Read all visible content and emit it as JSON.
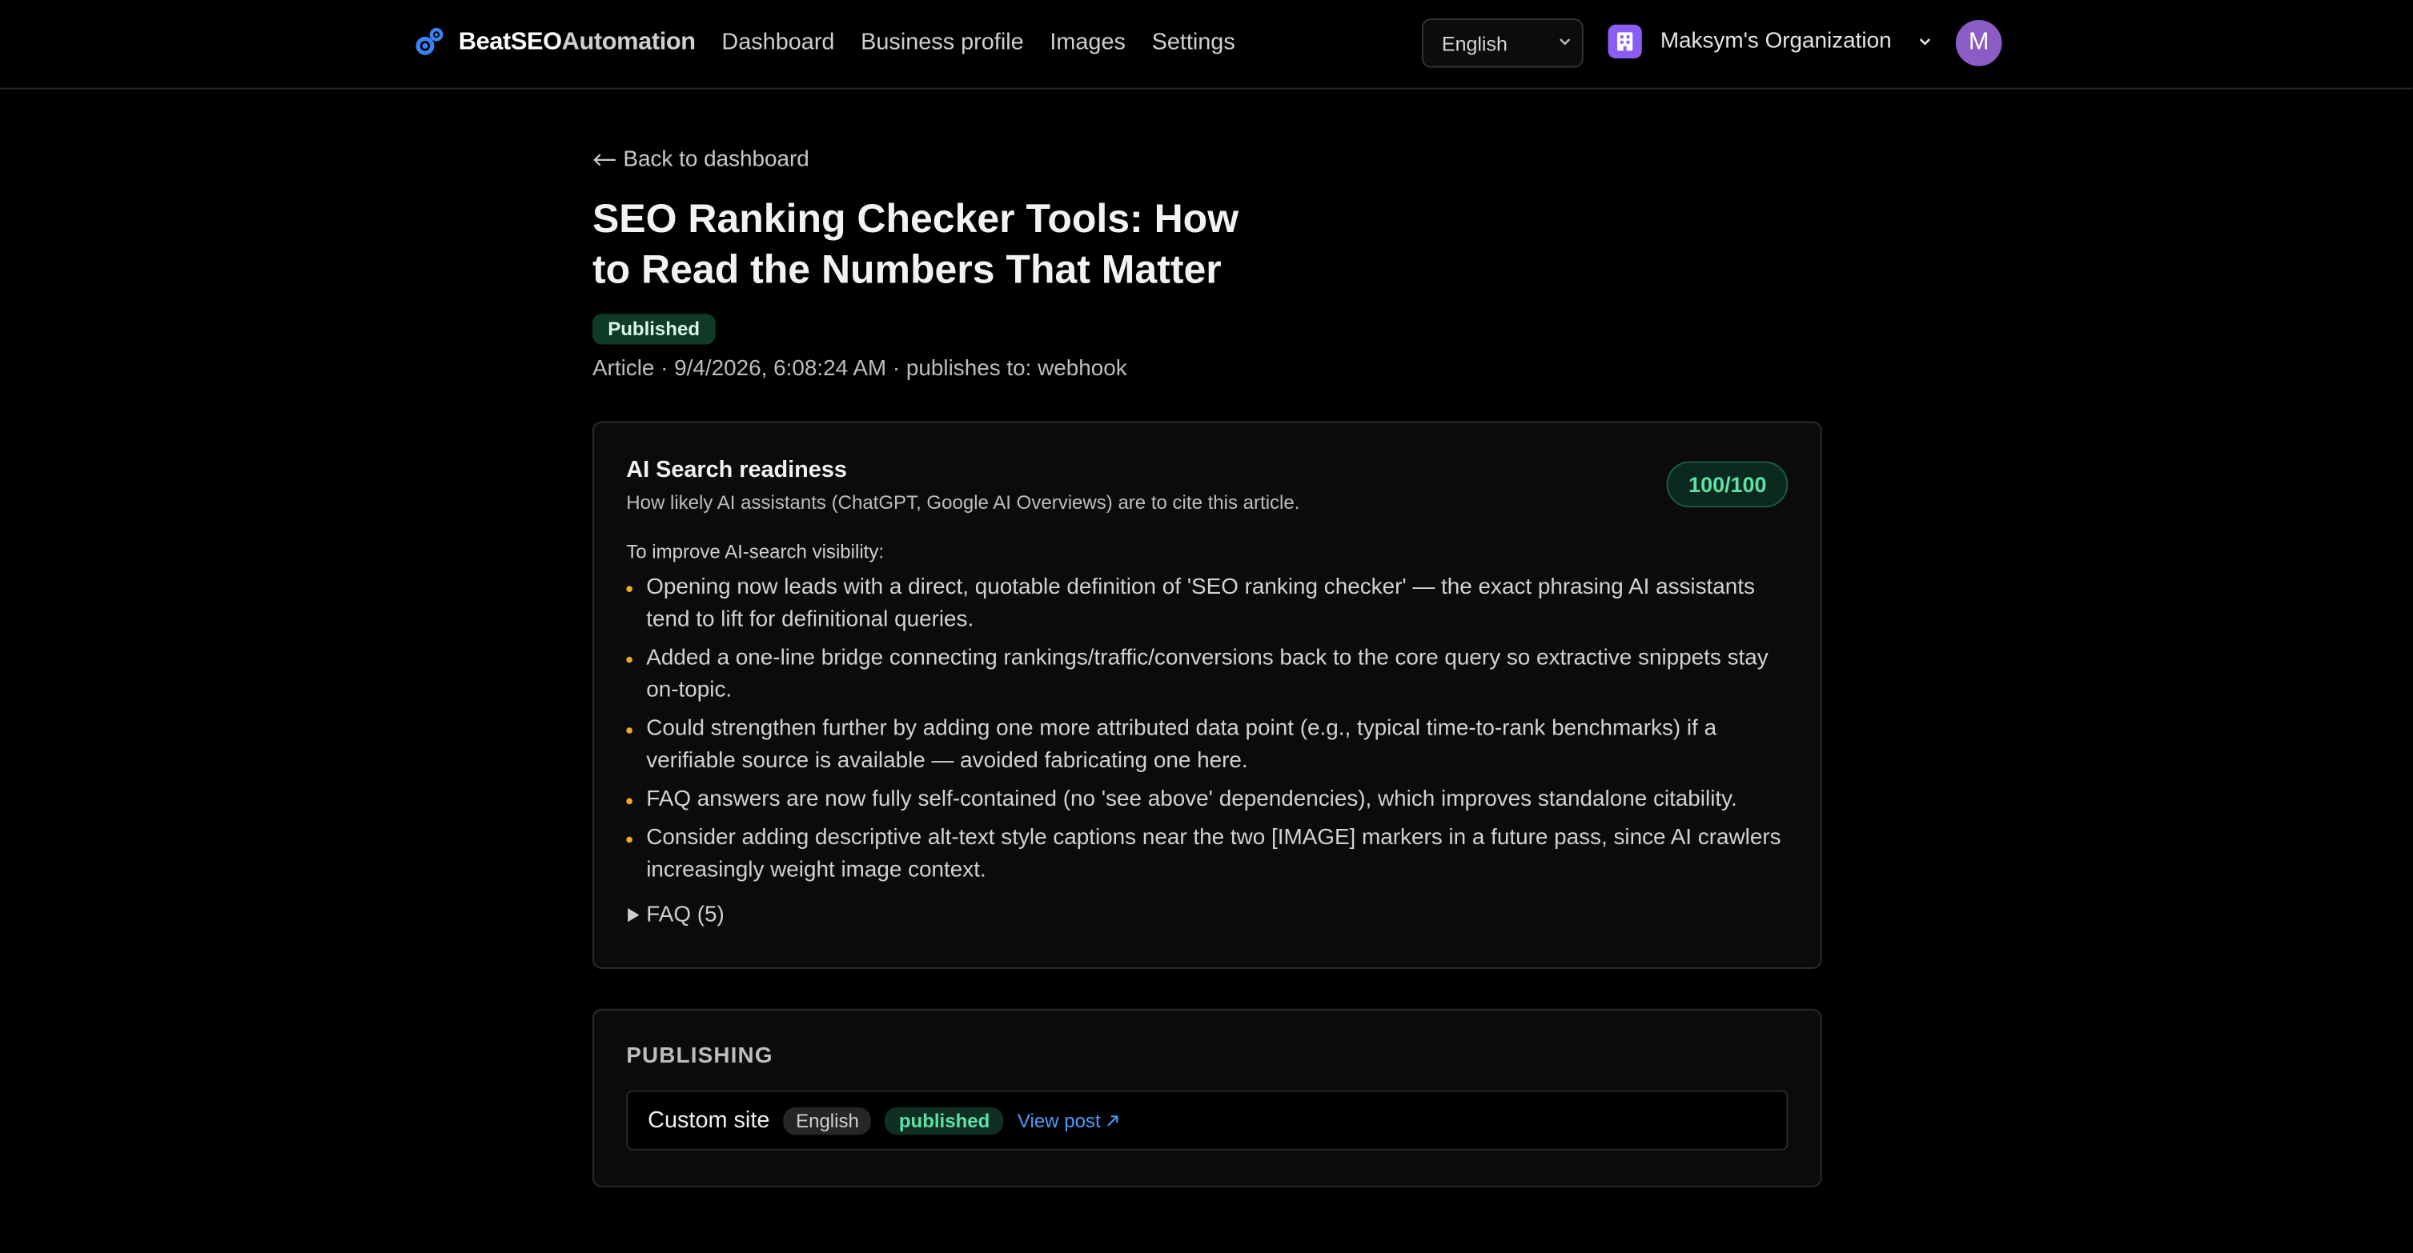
{
  "header": {
    "brand_bold": "BeatSEO",
    "brand_light": "Automation",
    "nav": [
      "Dashboard",
      "Business profile",
      "Images",
      "Settings"
    ],
    "language": "English",
    "org_name": "Maksym's Organization",
    "avatar_initial": "M"
  },
  "article": {
    "back_label": "Back to dashboard",
    "title": "SEO Ranking Checker Tools: How to Read the Numbers That Matter",
    "status": "Published",
    "meta": "Article · 9/4/2026, 6:08:24 AM · publishes to: webhook"
  },
  "ai_card": {
    "title": "AI Search readiness",
    "subtitle": "How likely AI assistants (ChatGPT, Google AI Overviews) are to cite this article.",
    "score": "100/100",
    "improve_label": "To improve AI-search visibility:",
    "bullets": [
      "Opening now leads with a direct, quotable definition of 'SEO ranking checker' — the exact phrasing AI assistants tend to lift for definitional queries.",
      "Added a one-line bridge connecting rankings/traffic/conversions back to the core query so extractive snippets stay on-topic.",
      "Could strengthen further by adding one more attributed data point (e.g., typical time-to-rank benchmarks) if a verifiable source is available — avoided fabricating one here.",
      "FAQ answers are now fully self-contained (no 'see above' dependencies), which improves standalone citability.",
      "Consider adding descriptive alt-text style captions near the two [IMAGE] markers in a future pass, since AI crawlers increasingly weight image context."
    ],
    "faq_label": "FAQ (5)"
  },
  "publishing": {
    "heading": "PUBLISHING",
    "site": "Custom site",
    "language": "English",
    "status": "published",
    "view_label": "View post"
  },
  "colors": {
    "background": "#000000",
    "accent_green": "#5ee0a6",
    "bullet_orange": "#f0a72a",
    "link_blue": "#4c9cff",
    "org_purple": "#8b5cf6"
  }
}
